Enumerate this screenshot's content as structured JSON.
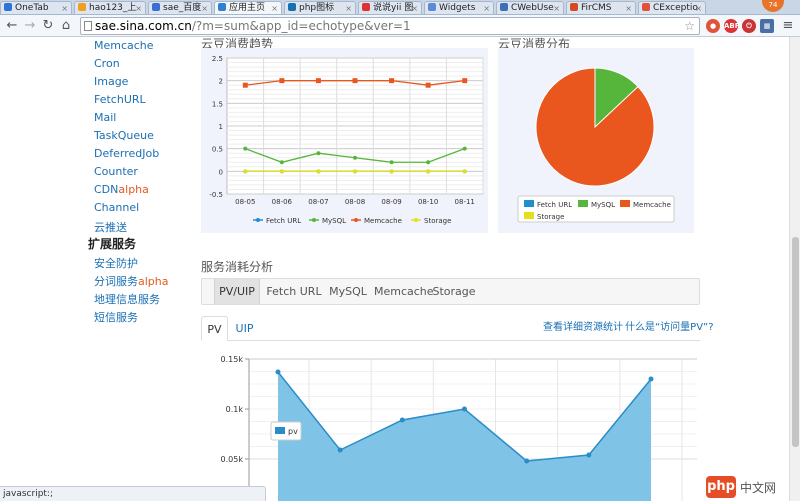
{
  "browser": {
    "tabs": [
      {
        "label": "OneTab",
        "color": "#2b73d6"
      },
      {
        "label": "hao123_上",
        "color": "#f0a020"
      },
      {
        "label": "sae_百度",
        "color": "#3c6fd4"
      },
      {
        "label": "应用主页",
        "color": "#2f7fd2",
        "active": true
      },
      {
        "label": "php图标",
        "color": "#1a6fb3"
      },
      {
        "label": "说说yii 图",
        "color": "#d33"
      },
      {
        "label": "Widgets",
        "color": "#5b8bd8"
      },
      {
        "label": "CWebUse",
        "color": "#3d6fb8"
      },
      {
        "label": "FirCMS",
        "color": "#d44a22"
      },
      {
        "label": "CExceptio",
        "color": "#e0533a"
      }
    ],
    "url_host": "sae.sina.com.cn",
    "url_rest": "/?m=sum&app_id=echotype&ver=1",
    "notification_count": "74",
    "ext_abp": "ABP"
  },
  "sidebar": {
    "items": [
      {
        "label": "Memcache"
      },
      {
        "label": "Cron"
      },
      {
        "label": "Image"
      },
      {
        "label": "FetchURL"
      },
      {
        "label": "Mail"
      },
      {
        "label": "TaskQueue"
      },
      {
        "label": "DeferredJob"
      },
      {
        "label": "Counter"
      },
      {
        "label": "CDN",
        "suffix": "alpha"
      },
      {
        "label": "Channel"
      },
      {
        "label": "云推送"
      }
    ],
    "section_head": "扩展服务",
    "ext_items": [
      {
        "label": "安全防护"
      },
      {
        "label": "分词服务",
        "suffix": "alpha"
      },
      {
        "label": "地理信息服务"
      },
      {
        "label": "短信服务"
      }
    ]
  },
  "trend_panel": {
    "title": "云豆消费趋势"
  },
  "dist_panel": {
    "title": "云豆消费分布"
  },
  "consume": {
    "title": "服务消耗分析",
    "subtabs": [
      "PV/UIP",
      "Fetch URL",
      "MySQL",
      "Memcache",
      "Storage"
    ],
    "pvtabs": [
      "PV",
      "UIP"
    ],
    "link_detail": "查看详细资源统计",
    "link_what": "什么是“访问量PV”?"
  },
  "status_bar": "javascript:;",
  "watermark": {
    "logo": "php",
    "text": "中文网"
  },
  "colors": {
    "fetch_url": "#1f8fd0",
    "mysql": "#56b63b",
    "memcache": "#e9561e",
    "storage": "#e3e01a",
    "pv_fill": "#7fc3e6",
    "pv_line": "#2a8cc8"
  },
  "chart_data": [
    {
      "type": "line",
      "x": [
        "08-05",
        "08-06",
        "08-07",
        "08-08",
        "08-09",
        "08-10",
        "08-11"
      ],
      "ylim": [
        -0.5,
        2.5
      ],
      "yticks": [
        "2.5",
        "2",
        "1.5",
        "1",
        "0.5",
        "0",
        "-0.5"
      ],
      "series": [
        {
          "name": "Fetch URL",
          "values": [
            0,
            0,
            0,
            0,
            0,
            0,
            0
          ]
        },
        {
          "name": "MySQL",
          "values": [
            0.5,
            0.2,
            0.4,
            0.3,
            0.2,
            0.2,
            0.5
          ]
        },
        {
          "name": "Memcache",
          "values": [
            1.9,
            2.0,
            2.0,
            2.0,
            2.0,
            1.9,
            2.0
          ]
        },
        {
          "name": "Storage",
          "values": [
            0,
            0,
            0,
            0,
            0,
            0,
            0
          ]
        }
      ],
      "grid": true,
      "legend": "bottom"
    },
    {
      "type": "pie",
      "labels": [
        "Fetch URL",
        "MySQL",
        "Memcache",
        "Storage"
      ],
      "values": [
        0,
        13,
        87,
        0
      ],
      "legend": "bottom"
    },
    {
      "type": "area",
      "series": [
        {
          "name": "pv",
          "values": [
            0.137,
            0.059,
            0.089,
            0.1,
            0.048,
            0.054,
            0.13
          ]
        }
      ],
      "ylim": [
        0.03,
        0.15
      ],
      "yticks": [
        "0.15k",
        "0.1k",
        "0.05k"
      ],
      "grid": true,
      "legend": "left"
    }
  ]
}
